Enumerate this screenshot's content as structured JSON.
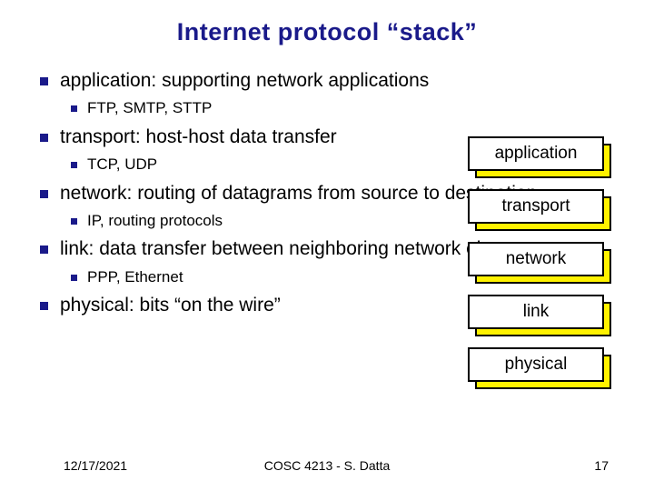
{
  "title": "Internet protocol “stack”",
  "bullets": [
    {
      "main_pre": "application:",
      "main_post": " supporting network applications",
      "sub": "FTP, SMTP, STTP"
    },
    {
      "main_pre": "transport:",
      "main_post": " host-host data transfer",
      "sub": "TCP, UDP"
    },
    {
      "main_pre": "network:",
      "main_post": " routing of datagrams from source to destination",
      "sub": "IP, routing protocols"
    },
    {
      "main_pre": "link:",
      "main_post": " data transfer between neighboring  network elements",
      "sub": "PPP, Ethernet"
    },
    {
      "main_pre": "physical:",
      "main_post": " bits “on the wire”",
      "sub": null
    }
  ],
  "layers": [
    "application",
    "transport",
    "network",
    "link",
    "physical"
  ],
  "footer": {
    "date": "12/17/2021",
    "course": "COSC 4213 - S. Datta",
    "page": "17"
  },
  "colors": {
    "accent": "#1a1a8a",
    "highlight": "#fff200"
  }
}
